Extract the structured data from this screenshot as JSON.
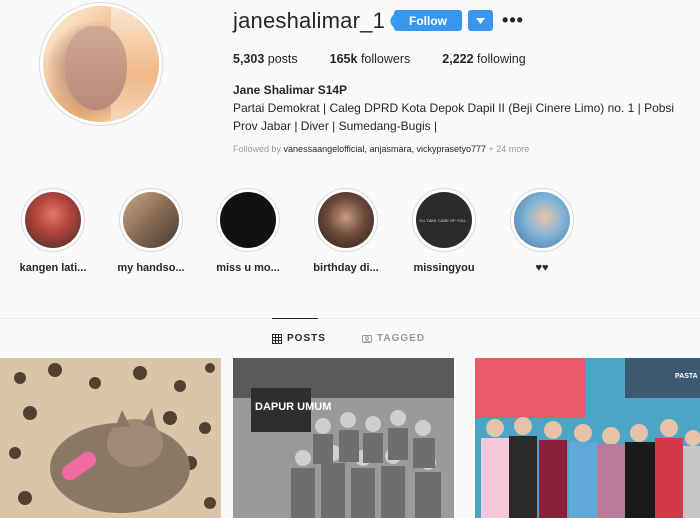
{
  "profile": {
    "username": "janeshalimar_1",
    "verified": true,
    "follow_label": "Follow",
    "more_label": "•••",
    "stats": {
      "posts_count": "5,303",
      "posts_label": "posts",
      "followers_count": "165k",
      "followers_label": "followers",
      "following_count": "2,222",
      "following_label": "following"
    },
    "full_name": "Jane Shalimar S14P",
    "bio": "Partai Demokrat | Caleg DPRD Kota Depok Dapil II (Beji Cinere Limo) no. 1 | Pobsi Prov Jabar | Diver | Sumedang-Bugis |",
    "followed_by_prefix": "Followed by",
    "followed_by_names": "vanessaangelofficial, anjasmara, vickyprasetyo777",
    "followed_by_more": "+ 24 more"
  },
  "highlights": [
    {
      "label": "kangen lati...",
      "color": "#b4443c"
    },
    {
      "label": "my handso...",
      "color": "#8a6a52"
    },
    {
      "label": "miss u mo...",
      "color": "#111111"
    },
    {
      "label": "birthday di...",
      "color": "#6d4a3c"
    },
    {
      "label": "missingyou",
      "color": "#2b2b2b"
    },
    {
      "label": "♥♥",
      "color": "#7fb3d9"
    }
  ],
  "highlight_4_image_text": "I'LL TAKE CARE OF YOU...",
  "tabs": {
    "posts": "POSTS",
    "tagged": "TAGGED"
  },
  "posts": [
    {
      "overlay_text": ""
    },
    {
      "overlay_text": "DAPUR UMUM"
    },
    {
      "overlay_text": "PASTA"
    }
  ],
  "colors": {
    "accent": "#3897f0",
    "text": "#262626",
    "muted": "#999999",
    "background": "#fafafa"
  }
}
